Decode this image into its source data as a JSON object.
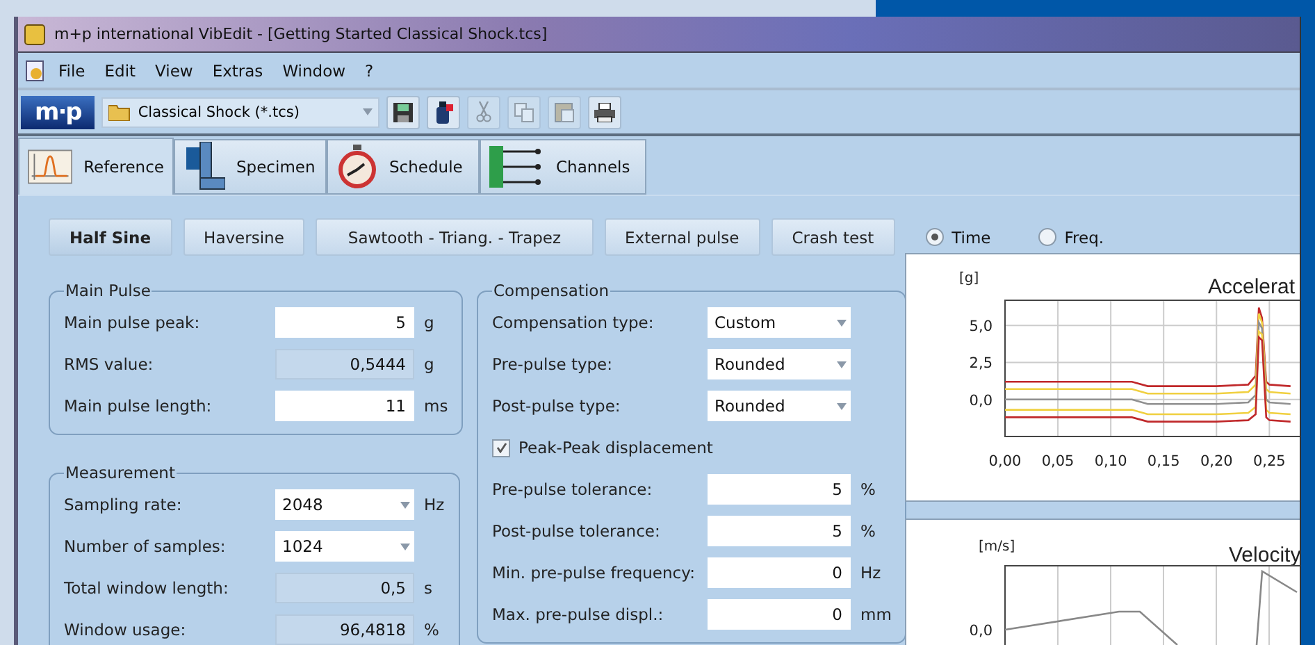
{
  "window": {
    "title": "m+p international VibEdit - [Getting Started Classical Shock.tcs]"
  },
  "menu": [
    {
      "label": "File"
    },
    {
      "label": "Edit"
    },
    {
      "label": "View"
    },
    {
      "label": "Extras"
    },
    {
      "label": "Window"
    },
    {
      "label": "?"
    }
  ],
  "toolbar": {
    "logo": "m·p",
    "file_type": "Classical Shock (*.tcs)",
    "buttons": [
      {
        "kind": "save",
        "disabled": false
      },
      {
        "kind": "bottle",
        "disabled": false
      },
      {
        "kind": "cut",
        "disabled": true
      },
      {
        "kind": "copy",
        "disabled": true
      },
      {
        "kind": "paste",
        "disabled": true
      },
      {
        "kind": "print",
        "disabled": false
      }
    ]
  },
  "tabs": [
    {
      "label": "Reference",
      "kind": "reference",
      "selected": true
    },
    {
      "label": "Specimen",
      "kind": "specimen",
      "selected": false
    },
    {
      "label": "Schedule",
      "kind": "schedule",
      "selected": false
    },
    {
      "label": "Channels",
      "kind": "channels",
      "selected": false
    }
  ],
  "pulse_types": [
    {
      "label": "Half Sine",
      "selected": true
    },
    {
      "label": "Haversine",
      "selected": false
    },
    {
      "label": "Sawtooth - Triang. - Trapez",
      "selected": false
    },
    {
      "label": "External pulse",
      "selected": false
    },
    {
      "label": "Crash test",
      "selected": false
    }
  ],
  "domain": [
    {
      "label": "Time",
      "selected": true
    },
    {
      "label": "Freq.",
      "selected": false
    }
  ],
  "main_pulse": {
    "title": "Main Pulse",
    "fields": [
      {
        "label": "Main pulse peak:",
        "kind": "input",
        "value": "5",
        "unit": "g"
      },
      {
        "label": "RMS value:",
        "kind": "readonly",
        "value": "0,5444",
        "unit": "g"
      },
      {
        "label": "Main pulse length:",
        "kind": "input",
        "value": "11",
        "unit": "ms"
      }
    ]
  },
  "measurement": {
    "title": "Measurement",
    "fields": [
      {
        "label": "Sampling rate:",
        "kind": "select",
        "value": "2048",
        "unit": "Hz"
      },
      {
        "label": "Number of samples:",
        "kind": "select",
        "value": "1024"
      },
      {
        "label": "Total window length:",
        "kind": "readonly",
        "value": "0,5",
        "unit": "s"
      },
      {
        "label": "Window usage:",
        "kind": "readonly",
        "value": "96,4818",
        "unit": "%"
      }
    ]
  },
  "compensation": {
    "title": "Compensation",
    "fields": [
      {
        "label": "Compensation type:",
        "kind": "select",
        "value": "Custom"
      },
      {
        "label": "Pre-pulse type:",
        "kind": "select",
        "value": "Rounded"
      },
      {
        "label": "Post-pulse type:",
        "kind": "select",
        "value": "Rounded"
      },
      {
        "label": "Peak-Peak displacement",
        "kind": "checkbox",
        "checked": true
      },
      {
        "label": "Pre-pulse tolerance:",
        "kind": "input",
        "value": "5",
        "unit": "%"
      },
      {
        "label": "Post-pulse tolerance:",
        "kind": "input",
        "value": "5",
        "unit": "%"
      },
      {
        "label": "Min. pre-pulse frequency:",
        "kind": "input",
        "value": "0",
        "unit": "Hz"
      },
      {
        "label": "Max. pre-pulse displ.:",
        "kind": "input",
        "value": "0",
        "unit": "mm"
      }
    ]
  },
  "acceleration": {
    "unit": "[g]",
    "title": "Accelerat",
    "chart_data": {
      "type": "line",
      "x": [
        0,
        0.05,
        0.1,
        0.12,
        0.135,
        0.2,
        0.23,
        0.237,
        0.24,
        0.243,
        0.247,
        0.25,
        0.27
      ],
      "grid": true,
      "xlim": [
        0,
        0.28
      ],
      "ylim": [
        -2.5,
        6.7
      ],
      "xticks": [
        {
          "value": 0,
          "label": "0,00"
        },
        {
          "value": 0.05,
          "label": "0,05"
        },
        {
          "value": 0.1,
          "label": "0,10"
        },
        {
          "value": 0.15,
          "label": "0,15"
        },
        {
          "value": 0.2,
          "label": "0,20"
        },
        {
          "value": 0.25,
          "label": "0,25"
        }
      ],
      "yticks": [
        {
          "value": 0,
          "label": "0,0"
        },
        {
          "value": 2.5,
          "label": "2,5"
        },
        {
          "value": 5,
          "label": "5,0"
        }
      ],
      "series": [
        {
          "color": "#c0282a",
          "values": [
            1.2,
            1.2,
            1.2,
            1.2,
            0.9,
            0.9,
            1.0,
            1.6,
            6.2,
            5.5,
            1.2,
            1.0,
            0.9
          ]
        },
        {
          "color": "#f0d040",
          "values": [
            0.7,
            0.7,
            0.7,
            0.7,
            0.4,
            0.4,
            0.5,
            1.0,
            5.8,
            5.2,
            0.7,
            0.5,
            0.4
          ]
        },
        {
          "color": "#909090",
          "values": [
            0,
            0,
            0,
            0,
            -0.3,
            -0.3,
            -0.2,
            0.3,
            5.2,
            4.8,
            0,
            -0.2,
            -0.3
          ]
        },
        {
          "color": "#f0d040",
          "values": [
            -0.7,
            -0.7,
            -0.7,
            -0.7,
            -1.0,
            -1.0,
            -0.9,
            -0.5,
            4.6,
            4.4,
            -0.7,
            -0.9,
            -1.0
          ]
        },
        {
          "color": "#c0282a",
          "values": [
            -1.2,
            -1.2,
            -1.2,
            -1.2,
            -1.5,
            -1.5,
            -1.4,
            -1.0,
            4.2,
            4.0,
            -1.2,
            -1.4,
            -1.5
          ]
        }
      ]
    }
  },
  "velocity": {
    "unit": "[m/s]",
    "title": "Velocity",
    "y_tick": "0,0"
  }
}
